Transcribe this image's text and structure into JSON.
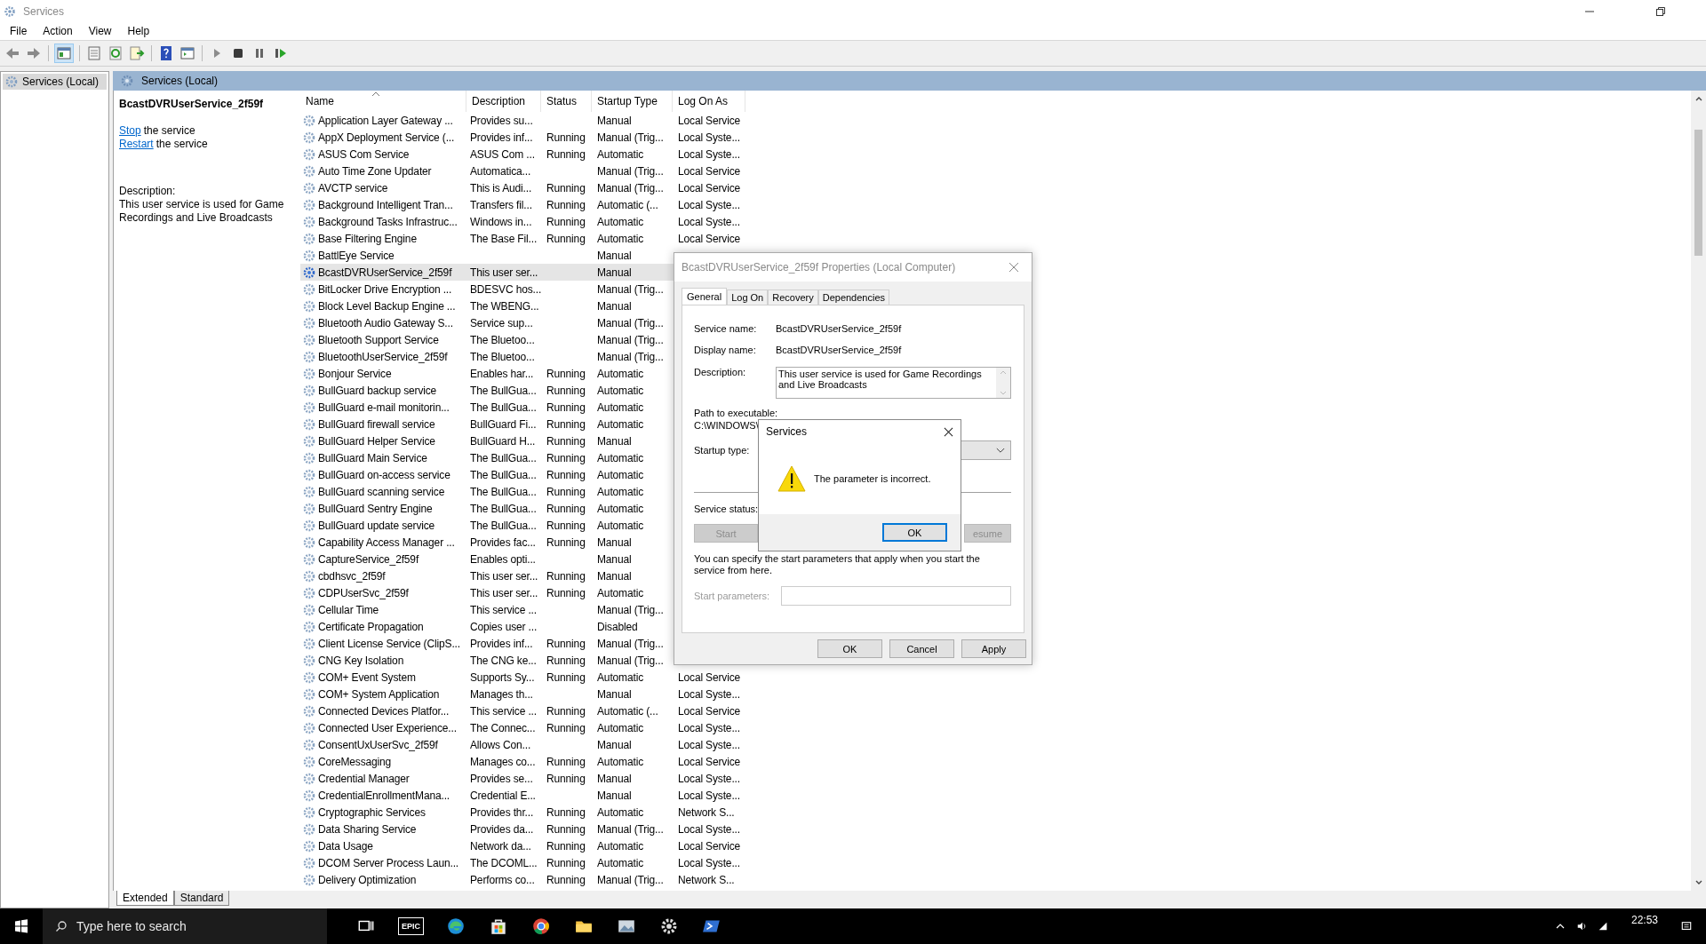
{
  "window": {
    "title": "Services",
    "menu": [
      "File",
      "Action",
      "View",
      "Help"
    ]
  },
  "tree": {
    "items": [
      {
        "label": "Services (Local)",
        "selected": true
      }
    ]
  },
  "pane": {
    "title": "Services (Local)"
  },
  "extended": {
    "service_name": "BcastDVRUserService_2f59f",
    "actions": [
      {
        "link": "Stop",
        "text": "the service"
      },
      {
        "link": "Restart",
        "text": "the service"
      }
    ],
    "description_label": "Description:",
    "description": "This user service is used for Game Recordings and Live Broadcasts"
  },
  "table": {
    "columns": [
      "Name",
      "Description",
      "Status",
      "Startup Type",
      "Log On As"
    ],
    "rows": [
      {
        "name": "Application Layer Gateway ...",
        "description": "Provides su...",
        "startup": "Manual",
        "logon": "Local Service",
        "selected": false
      },
      {
        "name": "AppX Deployment Service (...",
        "description": "Provides inf...",
        "status": "Running",
        "startup": "Manual (Trig...",
        "logon": "Local Syste...",
        "selected": false
      },
      {
        "name": "ASUS Com Service",
        "description": "ASUS Com ...",
        "status": "Running",
        "startup": "Automatic",
        "logon": "Local Syste...",
        "selected": false
      },
      {
        "name": "Auto Time Zone Updater",
        "description": "Automatica...",
        "startup": "Manual (Trig...",
        "logon": "Local Service",
        "selected": false
      },
      {
        "name": "AVCTP service",
        "description": "This is Audi...",
        "status": "Running",
        "startup": "Manual (Trig...",
        "logon": "Local Service",
        "selected": false
      },
      {
        "name": "Background Intelligent Tran...",
        "description": "Transfers fil...",
        "status": "Running",
        "startup": "Automatic (...",
        "logon": "Local Syste...",
        "selected": false
      },
      {
        "name": "Background Tasks Infrastruc...",
        "description": "Windows in...",
        "status": "Running",
        "startup": "Automatic",
        "logon": "Local Syste...",
        "selected": false
      },
      {
        "name": "Base Filtering Engine",
        "description": "The Base Fil...",
        "status": "Running",
        "startup": "Automatic",
        "logon": "Local Service",
        "selected": false
      },
      {
        "name": "BattlEye Service",
        "startup": "Manual",
        "selected": false
      },
      {
        "name": "BcastDVRUserService_2f59f",
        "description": "This user ser...",
        "startup": "Manual",
        "selected": true
      },
      {
        "name": "BitLocker Drive Encryption ...",
        "description": "BDESVC hos...",
        "startup": "Manual (Trig...",
        "selected": false
      },
      {
        "name": "Block Level Backup Engine ...",
        "description": "The WBENG...",
        "startup": "Manual",
        "selected": false
      },
      {
        "name": "Bluetooth Audio Gateway S...",
        "description": "Service sup...",
        "startup": "Manual (Trig...",
        "selected": false
      },
      {
        "name": "Bluetooth Support Service",
        "description": "The Bluetoo...",
        "startup": "Manual (Trig...",
        "selected": false
      },
      {
        "name": "BluetoothUserService_2f59f",
        "description": "The Bluetoo...",
        "startup": "Manual (Trig...",
        "selected": false
      },
      {
        "name": "Bonjour Service",
        "description": "Enables har...",
        "status": "Running",
        "startup": "Automatic",
        "selected": false
      },
      {
        "name": "BullGuard backup service",
        "description": "The BullGua...",
        "status": "Running",
        "startup": "Automatic",
        "selected": false
      },
      {
        "name": "BullGuard e-mail monitorin...",
        "description": "The BullGua...",
        "status": "Running",
        "startup": "Automatic",
        "selected": false
      },
      {
        "name": "BullGuard firewall service",
        "description": "BullGuard Fi...",
        "status": "Running",
        "startup": "Automatic",
        "selected": false
      },
      {
        "name": "BullGuard Helper Service",
        "description": "BullGuard H...",
        "status": "Running",
        "startup": "Manual",
        "selected": false
      },
      {
        "name": "BullGuard Main Service",
        "description": "The BullGua...",
        "status": "Running",
        "startup": "Automatic",
        "selected": false
      },
      {
        "name": "BullGuard on-access service",
        "description": "The BullGua...",
        "status": "Running",
        "startup": "Automatic",
        "selected": false
      },
      {
        "name": "BullGuard scanning service",
        "description": "The BullGua...",
        "status": "Running",
        "startup": "Automatic",
        "selected": false
      },
      {
        "name": "BullGuard Sentry Engine",
        "description": "The BullGua...",
        "status": "Running",
        "startup": "Automatic",
        "selected": false
      },
      {
        "name": "BullGuard update service",
        "description": "The BullGua...",
        "status": "Running",
        "startup": "Automatic",
        "selected": false
      },
      {
        "name": "Capability Access Manager ...",
        "description": "Provides fac...",
        "status": "Running",
        "startup": "Manual",
        "selected": false
      },
      {
        "name": "CaptureService_2f59f",
        "description": "Enables opti...",
        "startup": "Manual",
        "selected": false
      },
      {
        "name": "cbdhsvc_2f59f",
        "description": "This user ser...",
        "status": "Running",
        "startup": "Manual",
        "selected": false
      },
      {
        "name": "CDPUserSvc_2f59f",
        "description": "This user ser...",
        "status": "Running",
        "startup": "Automatic",
        "selected": false
      },
      {
        "name": "Cellular Time",
        "description": "This service ...",
        "startup": "Manual (Trig...",
        "selected": false
      },
      {
        "name": "Certificate Propagation",
        "description": "Copies user ...",
        "startup": "Disabled",
        "selected": false
      },
      {
        "name": "Client License Service (ClipS...",
        "description": "Provides inf...",
        "status": "Running",
        "startup": "Manual (Trig...",
        "selected": false
      },
      {
        "name": "CNG Key Isolation",
        "description": "The CNG ke...",
        "status": "Running",
        "startup": "Manual (Trig...",
        "selected": false
      },
      {
        "name": "COM+ Event System",
        "description": "Supports Sy...",
        "status": "Running",
        "startup": "Automatic",
        "logon": "Local Service",
        "selected": false
      },
      {
        "name": "COM+ System Application",
        "description": "Manages th...",
        "startup": "Manual",
        "logon": "Local Syste...",
        "selected": false
      },
      {
        "name": "Connected Devices Platfor...",
        "description": "This service ...",
        "status": "Running",
        "startup": "Automatic (...",
        "logon": "Local Service",
        "selected": false
      },
      {
        "name": "Connected User Experience...",
        "description": "The Connec...",
        "status": "Running",
        "startup": "Automatic",
        "logon": "Local Syste...",
        "selected": false
      },
      {
        "name": "ConsentUxUserSvc_2f59f",
        "description": "Allows Con...",
        "startup": "Manual",
        "logon": "Local Syste...",
        "selected": false
      },
      {
        "name": "CoreMessaging",
        "description": "Manages co...",
        "status": "Running",
        "startup": "Automatic",
        "logon": "Local Service",
        "selected": false
      },
      {
        "name": "Credential Manager",
        "description": "Provides se...",
        "status": "Running",
        "startup": "Manual",
        "logon": "Local Syste...",
        "selected": false
      },
      {
        "name": "CredentialEnrollmentMana...",
        "description": "Credential E...",
        "startup": "Manual",
        "logon": "Local Syste...",
        "selected": false
      },
      {
        "name": "Cryptographic Services",
        "description": "Provides thr...",
        "status": "Running",
        "startup": "Automatic",
        "logon": "Network S...",
        "selected": false
      },
      {
        "name": "Data Sharing Service",
        "description": "Provides da...",
        "status": "Running",
        "startup": "Manual (Trig...",
        "logon": "Local Syste...",
        "selected": false
      },
      {
        "name": "Data Usage",
        "description": "Network da...",
        "status": "Running",
        "startup": "Automatic",
        "logon": "Local Service",
        "selected": false
      },
      {
        "name": "DCOM Server Process Laun...",
        "description": "The DCOML...",
        "status": "Running",
        "startup": "Automatic",
        "logon": "Local Syste...",
        "selected": false
      },
      {
        "name": "Delivery Optimization",
        "description": "Performs co...",
        "status": "Running",
        "startup": "Manual (Trig...",
        "logon": "Network S...",
        "selected": false
      }
    ]
  },
  "view_tabs": [
    {
      "label": "Extended",
      "selected": true
    },
    {
      "label": "Standard",
      "selected": false
    }
  ],
  "properties_dialog": {
    "title": "BcastDVRUserService_2f59f Properties (Local Computer)",
    "tabs": [
      {
        "label": "General",
        "selected": true
      },
      {
        "label": "Log On",
        "selected": false
      },
      {
        "label": "Recovery",
        "selected": false
      },
      {
        "label": "Dependencies",
        "selected": false
      }
    ],
    "fields": [
      {
        "label": "Service name:",
        "value": "BcastDVRUserService_2f59f"
      },
      {
        "label": "Display name:",
        "value": "BcastDVRUserService_2f59f"
      }
    ],
    "description": {
      "label": "Description:",
      "value": "This user service is used for Game Recordings and Live Broadcasts"
    },
    "path": {
      "label": "Path to executable:",
      "value": "C:\\WINDOWS\\"
    },
    "startup_type": {
      "label": "Startup type:"
    },
    "service_status": {
      "label": "Service status:"
    },
    "buttons": [
      {
        "label": "Start",
        "disabled": true
      },
      {
        "label": "esume",
        "disabled": true
      }
    ],
    "hint": "You can specify the start parameters that apply when you start the service from here.",
    "start_parameters": {
      "label": "Start parameters:",
      "disabled": true
    },
    "footer_buttons": [
      "OK",
      "Cancel",
      "Apply"
    ]
  },
  "message_box": {
    "title": "Services",
    "message": "The parameter is incorrect.",
    "button": "OK"
  },
  "taskbar": {
    "search_placeholder": "Type here to search",
    "apps": [
      {
        "kind": "taskview"
      },
      {
        "kind": "epic",
        "label": "EPIC"
      },
      {
        "kind": "edge"
      },
      {
        "kind": "store"
      },
      {
        "kind": "chrome"
      },
      {
        "kind": "folder"
      },
      {
        "kind": "photos"
      },
      {
        "kind": "settings"
      },
      {
        "kind": "terminal"
      }
    ],
    "time": "22:53"
  }
}
